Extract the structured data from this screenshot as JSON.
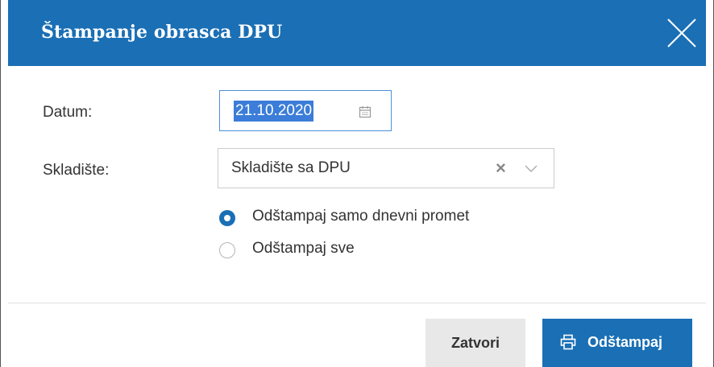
{
  "dialog": {
    "title": "Štampanje obrasca DPU",
    "close_icon": "close-icon"
  },
  "form": {
    "date_label": "Datum:",
    "date_value": "21.10.2020",
    "date_icon": "calendar-icon",
    "warehouse_label": "Skladište:",
    "warehouse_value": "Skladište sa DPU",
    "warehouse_clear_icon": "clear-icon",
    "warehouse_dropdown_icon": "chevron-down-icon",
    "print_options": [
      {
        "label": "Odštampaj samo dnevni promet",
        "selected": true
      },
      {
        "label": "Odštampaj sve",
        "selected": false
      }
    ]
  },
  "footer": {
    "close_label": "Zatvori",
    "print_label": "Odštampaj",
    "print_icon": "printer-icon"
  },
  "colors": {
    "header_bg": "#1a6fb5",
    "primary_button": "#1a6fb5",
    "secondary_button": "#e8e8e8",
    "date_selection": "#3b7dd8"
  }
}
